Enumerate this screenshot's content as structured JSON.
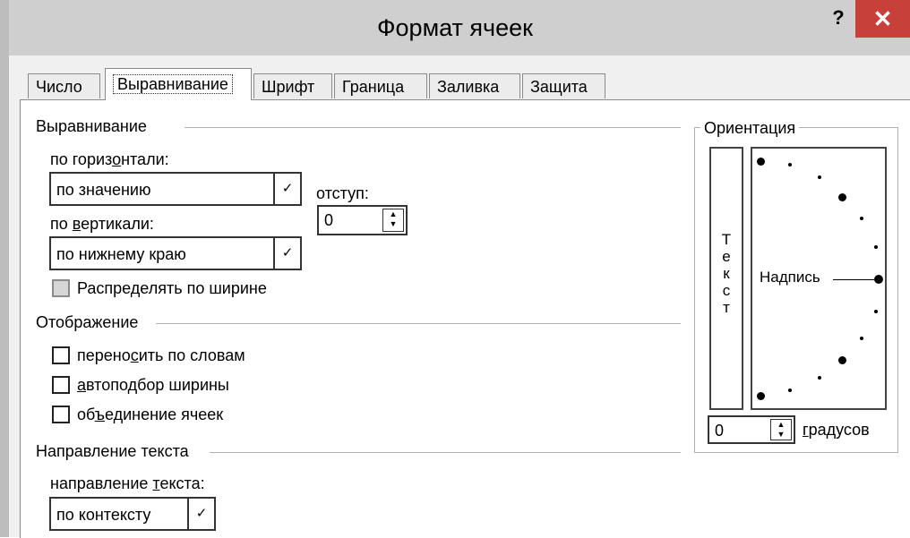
{
  "window": {
    "title": "Формат ячеек",
    "help_label": "?",
    "close_label": "✕"
  },
  "tabs": [
    {
      "label": "Число",
      "active": false
    },
    {
      "label": "Выравнивание",
      "active": true
    },
    {
      "label": "Шрифт",
      "active": false
    },
    {
      "label": "Граница",
      "active": false
    },
    {
      "label": "Заливка",
      "active": false
    },
    {
      "label": "Защита",
      "active": false
    }
  ],
  "alignment": {
    "section_label": "Выравнивание",
    "horizontal": {
      "label_pre": "по гориз",
      "label_key": "о",
      "label_post": "нтали:",
      "value": "по значению"
    },
    "indent": {
      "label": "отступ:",
      "value": "0"
    },
    "vertical": {
      "label_pre": "по ",
      "label_key": "в",
      "label_post": "ертикали:",
      "value": "по нижнему краю"
    },
    "distributed": {
      "label": "Распределять по ширине",
      "checked": false,
      "disabled": true
    }
  },
  "display": {
    "section_label": "Отображение",
    "wrap": {
      "label_pre": "перено",
      "label_key": "с",
      "label_post": "ить по словам",
      "checked": false
    },
    "shrink": {
      "label_pre": "",
      "label_key": "а",
      "label_post": "втоподбор ширины",
      "checked": false
    },
    "merge": {
      "label_pre": "об",
      "label_key": "ъ",
      "label_post": "единение ячеек",
      "checked": false
    }
  },
  "direction": {
    "section_label": "Направление текста",
    "field": {
      "label_pre": "направление ",
      "label_key": "т",
      "label_post": "екста:",
      "value": "по контексту"
    }
  },
  "orientation": {
    "section_label": "Ориентация",
    "vertical_text": [
      "Т",
      "е",
      "к",
      "с",
      "т"
    ],
    "dial_label": "Надпись",
    "degrees": {
      "value": "0",
      "label_key": "г",
      "label_post": "радусов"
    }
  },
  "icons": {
    "dropdown": "chevron-down-icon",
    "spinner": "spinner-arrows-icon",
    "close": "close-icon",
    "help": "help-icon"
  },
  "colors": {
    "close_button": "#c8403a",
    "titlebar": "#cfcfcf",
    "panel": "#ffffff"
  }
}
